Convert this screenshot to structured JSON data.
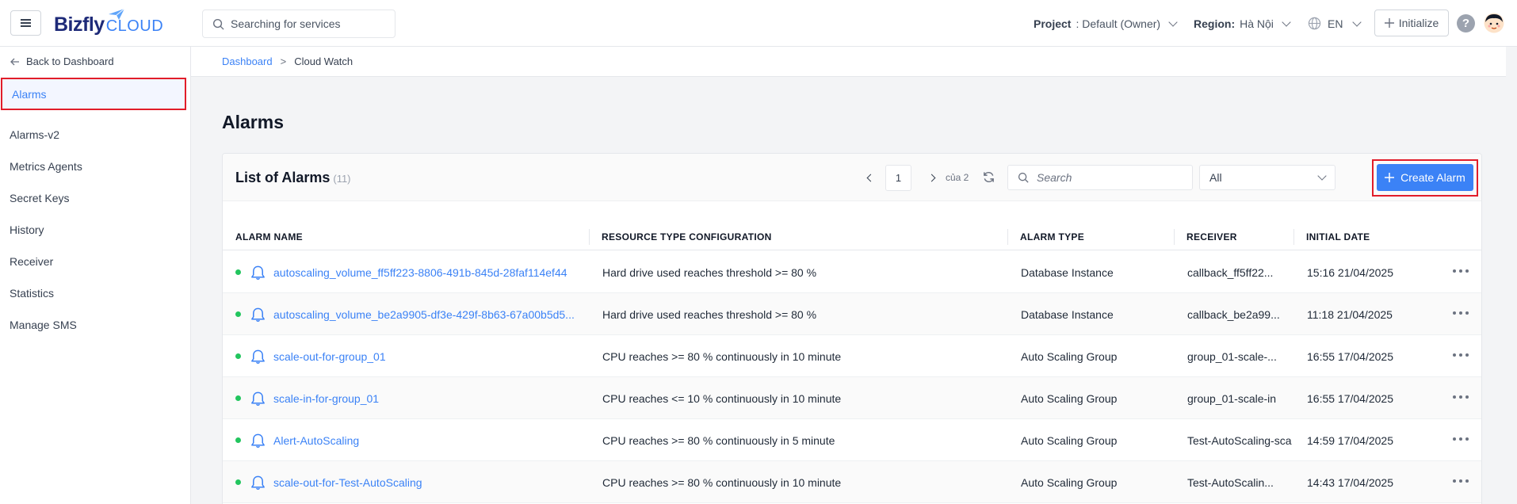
{
  "topbar": {
    "brand": "Bizfly",
    "brand_suffix": "CLOUD",
    "search_placeholder": "Searching for services",
    "project_label": "Project",
    "project_value": ": Default (Owner)",
    "region_label": "Region:",
    "region_value": "Hà Nội",
    "language": "EN",
    "initialize_label": "Initialize",
    "help": "?"
  },
  "sidebar": {
    "back_label": "Back to Dashboard",
    "items": [
      {
        "label": "Alarms",
        "active": true
      },
      {
        "label": "Alarms-v2"
      },
      {
        "label": "Metrics Agents"
      },
      {
        "label": "Secret Keys"
      },
      {
        "label": "History"
      },
      {
        "label": "Receiver"
      },
      {
        "label": "Statistics"
      },
      {
        "label": "Manage SMS"
      }
    ]
  },
  "breadcrumb": {
    "root": "Dashboard",
    "separator": ">",
    "current": "Cloud Watch"
  },
  "page": {
    "title": "Alarms"
  },
  "card": {
    "title": "List of Alarms",
    "count": "(11)",
    "page": "1",
    "page_of": "của 2",
    "search_placeholder": "Search",
    "filter_value": "All",
    "create_label": "Create Alarm"
  },
  "table": {
    "columns": [
      "ALARM NAME",
      "RESOURCE TYPE CONFIGURATION",
      "ALARM TYPE",
      "RECEIVER",
      "INITIAL DATE"
    ],
    "rows": [
      {
        "name": "autoscaling_volume_ff5ff223-8806-491b-845d-28faf114ef44",
        "config": "Hard drive used reaches threshold >= 80 %",
        "type": "Database Instance",
        "receiver": "callback_ff5ff22...",
        "date": "15:16 21/04/2025"
      },
      {
        "name": "autoscaling_volume_be2a9905-df3e-429f-8b63-67a00b5d5...",
        "config": "Hard drive used reaches threshold >= 80 %",
        "type": "Database Instance",
        "receiver": "callback_be2a99...",
        "date": "11:18 21/04/2025"
      },
      {
        "name": "scale-out-for-group_01",
        "config": "CPU reaches >= 80 % continuously in 10 minute",
        "type": "Auto Scaling Group",
        "receiver": "group_01-scale-...",
        "date": "16:55 17/04/2025"
      },
      {
        "name": "scale-in-for-group_01",
        "config": "CPU reaches <= 10 % continuously in 10 minute",
        "type": "Auto Scaling Group",
        "receiver": "group_01-scale-in",
        "date": "16:55 17/04/2025"
      },
      {
        "name": "Alert-AutoScaling",
        "config": "CPU reaches >= 80 % continuously in 5 minute",
        "type": "Auto Scaling Group",
        "receiver": "Test-AutoScaling-sca",
        "date": "14:59 17/04/2025"
      },
      {
        "name": "scale-out-for-Test-AutoScaling",
        "config": "CPU reaches >= 80 % continuously in 10 minute",
        "type": "Auto Scaling Group",
        "receiver": "Test-AutoScalin...",
        "date": "14:43 17/04/2025"
      }
    ]
  },
  "colors": {
    "accent": "#3b82f6",
    "highlight": "#e11d2a",
    "status_ok": "#22c55e"
  }
}
